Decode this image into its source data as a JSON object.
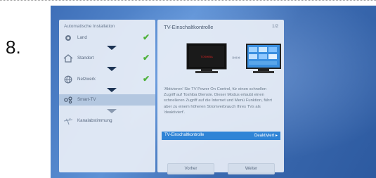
{
  "step_number": "8.",
  "left_panel": {
    "title": "Automatische Installation",
    "steps": [
      {
        "label": "Land",
        "icon": "gear-icon",
        "done": true
      },
      {
        "label": "Standort",
        "icon": "house-icon",
        "done": true
      },
      {
        "label": "Netzwerk",
        "icon": "globe-icon",
        "done": true
      },
      {
        "label": "Smart-TV",
        "icon": "smart-tv-icon",
        "done": false,
        "active": true
      },
      {
        "label": "Kanalabstimmung",
        "icon": "antenna-icon",
        "done": false
      }
    ],
    "check_glyph": "✔"
  },
  "right_panel": {
    "title": "TV-Einschaltkontrolle",
    "page": "1/2",
    "tv_brand": "TOSHIBA",
    "arrows": "»»»",
    "description": "'Aktivieren' Sie TV Power On Control, für einen schnellen Zugriff auf Toshiba Dienste. Dieser Modus erlaubt einen schnelleren Zugriff auf die Internet und Menü Funktion, führt aber zu einem höheren Stromverbrauch Ihres TVs als 'deaktiviert'.",
    "setting": {
      "label": "TV-Einschaltkontrolle",
      "value": "Deaktiviert",
      "indicator": "▸"
    },
    "buttons": {
      "back": "Vorher",
      "next": "Weiter"
    }
  },
  "colors": {
    "highlight": "#2f84d6",
    "check": "#4fb23c",
    "arrow": "#1d3454",
    "background": "#3e6fb8"
  }
}
